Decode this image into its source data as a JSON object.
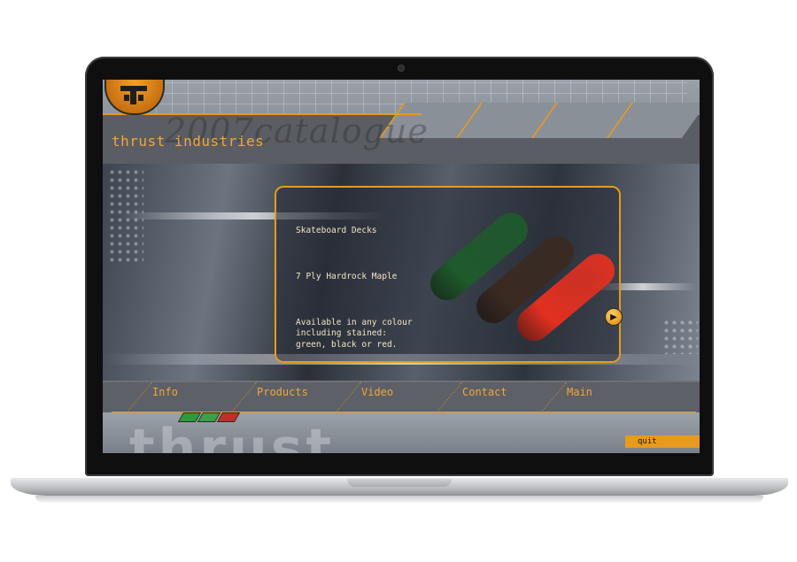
{
  "app": {
    "title": "thrust industries",
    "watermark_script": "2007catalogue",
    "watermark_logo": "thrust"
  },
  "panel": {
    "heading": "Skateboard Decks",
    "spec": "7 Ply Hardrock Maple",
    "description": "Available in any colour\nincluding stained:\ngreen, black or red.",
    "next_icon": "play-arrow-icon"
  },
  "boards": [
    {
      "name": "green",
      "color": "#1f5a2c"
    },
    {
      "name": "black",
      "color": "#3a2a22"
    },
    {
      "name": "red",
      "color": "#e23020"
    }
  ],
  "nav": {
    "items": [
      "Info",
      "Products",
      "Video",
      "Contact",
      "Main"
    ]
  },
  "swatches": [
    "#2e9b3a",
    "#3aa04a",
    "#c0302a"
  ],
  "footer": {
    "quit_label": "quit"
  },
  "colors": {
    "accent": "#e79a1e",
    "text": "#f2a53a"
  }
}
